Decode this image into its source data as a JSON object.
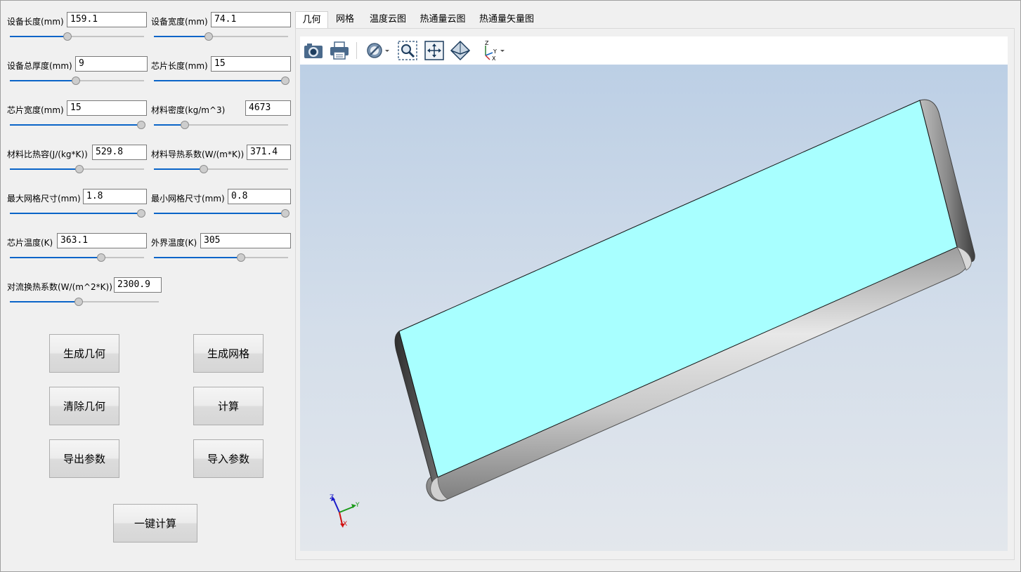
{
  "params": {
    "device_length": {
      "label": "设备长度(mm)",
      "value": "159.1",
      "slider": 0.43
    },
    "device_width": {
      "label": "设备宽度(mm)",
      "value": "74.1",
      "slider": 0.41
    },
    "device_thickness": {
      "label": "设备总厚度(mm)",
      "value": "9",
      "slider": 0.49
    },
    "chip_length": {
      "label": "芯片长度(mm)",
      "value": "15",
      "slider": 1.0
    },
    "chip_width": {
      "label": "芯片宽度(mm)",
      "value": "15",
      "slider": 1.0
    },
    "density": {
      "label": "材料密度(kg/m^3)",
      "value": "4673",
      "slider": 0.23
    },
    "specific_heat": {
      "label": "材料比热容(J/(kg*K))",
      "value": "529.8",
      "slider": 0.52
    },
    "conductivity": {
      "label": "材料导热系数(W/(m*K))",
      "value": "371.4",
      "slider": 0.37
    },
    "max_mesh": {
      "label": "最大网格尺寸(mm)",
      "value": "1.8",
      "slider": 1.0
    },
    "min_mesh": {
      "label": "最小网格尺寸(mm)",
      "value": "0.8",
      "slider": 1.0
    },
    "chip_temp": {
      "label": "芯片温度(K)",
      "value": "363.1",
      "slider": 0.68
    },
    "ambient_temp": {
      "label": "外界温度(K)",
      "value": "305",
      "slider": 0.65
    },
    "convection": {
      "label": "对流换热系数(W/(m^2*K))",
      "value": "2300.9",
      "slider": 0.46
    }
  },
  "buttons": {
    "gen_geometry": "生成几何",
    "gen_mesh": "生成网格",
    "clear_geometry": "清除几何",
    "compute": "计算",
    "export_params": "导出参数",
    "import_params": "导入参数",
    "one_click": "一键计算"
  },
  "tabs": [
    "几何",
    "网格",
    "温度云图",
    "热通量云图",
    "热通量矢量图"
  ],
  "toolbar": [
    "camera-icon",
    "print-icon",
    "clip-plane-icon",
    "zoom-box-icon",
    "fit-all-icon",
    "view-iso-icon",
    "axes-orientation-icon"
  ],
  "triad": {
    "x": "X",
    "y": "Y",
    "z": "Z"
  },
  "colors": {
    "face": "#a8ffff",
    "edge": "#8c8c8c",
    "accent": "#0a64c8"
  }
}
